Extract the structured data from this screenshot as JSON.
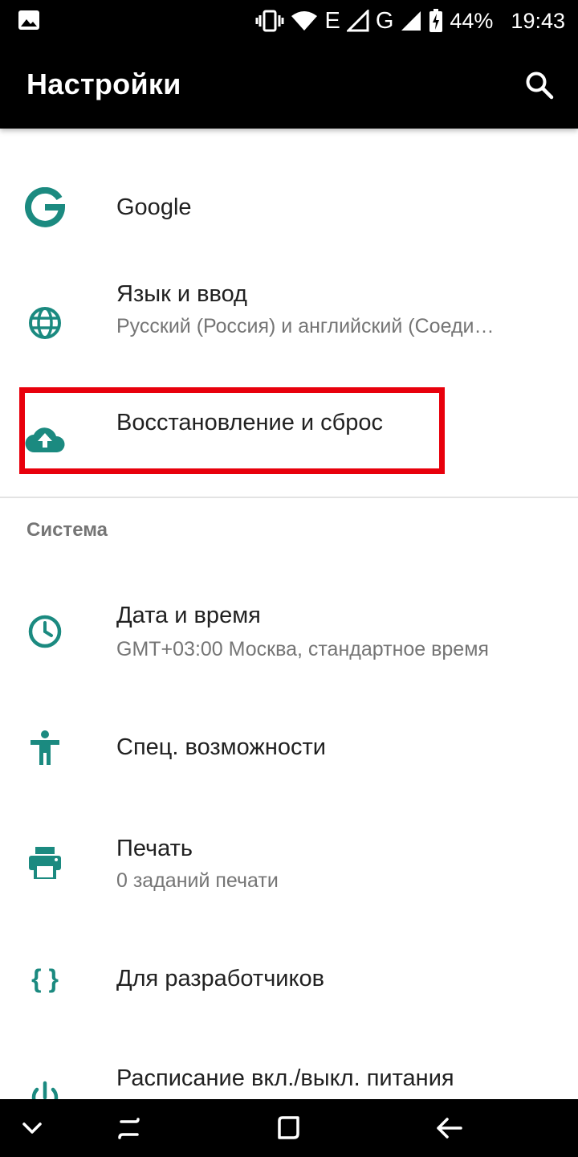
{
  "status_bar": {
    "net_e": "E",
    "net_g": "G",
    "battery": "44%",
    "time": "19:43"
  },
  "app_bar": {
    "title": "Настройки"
  },
  "items": [
    {
      "title": "Google",
      "icon": "google-icon"
    },
    {
      "title": "Язык и ввод",
      "subtitle": "Русский (Россия) и английский (Соеди…",
      "icon": "globe-icon"
    },
    {
      "title": "Восстановление и сброс",
      "icon": "cloud-upload-icon"
    }
  ],
  "section": {
    "title": "Система"
  },
  "system_items": [
    {
      "title": "Дата и время",
      "subtitle": "GMT+03:00 Москва, стандартное время",
      "icon": "clock-icon"
    },
    {
      "title": "Спец. возможности",
      "icon": "accessibility-icon"
    },
    {
      "title": "Печать",
      "subtitle": "0 заданий печати",
      "icon": "printer-icon"
    },
    {
      "title": "Для разработчиков",
      "icon": "developer-braces-icon"
    },
    {
      "title": "Расписание вкл./выкл. питания",
      "icon": "power-schedule-icon"
    }
  ],
  "colors": {
    "accent": "#1b8a80",
    "highlight": "#e8000c",
    "bars": "#000000"
  }
}
